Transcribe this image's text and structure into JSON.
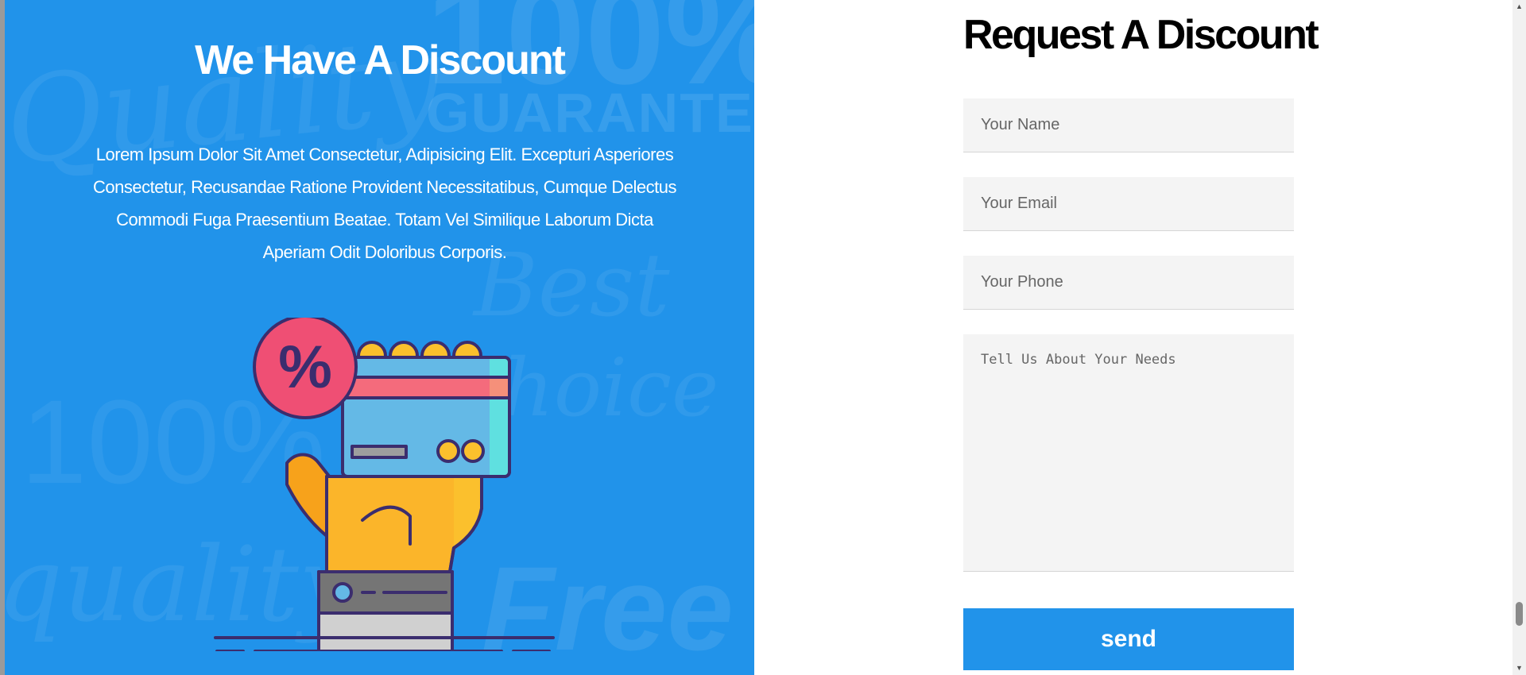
{
  "hero": {
    "title": "We Have A Discount",
    "description": "Lorem Ipsum Dolor Sit Amet Consectetur, Adipisicing Elit. Excepturi Asperiores Consectetur, Recusandae Ratione Provident Necessitatibus, Cumque Delectus Commodi Fuga Praesentium Beatae. Totam Vel Similique Laborum Dicta Aperiam Odit Doloribus Corporis.",
    "background_color": "#2193ea",
    "illustration_icon": "hand-holding-discount-card-illustration",
    "watermarks": [
      "Quality",
      "100%",
      "GUARANTEED",
      "Best",
      "Choice",
      "100%",
      "quality",
      "Free"
    ]
  },
  "form": {
    "title": "Request A Discount",
    "name_placeholder": "Your Name",
    "email_placeholder": "Your Email",
    "phone_placeholder": "Your Phone",
    "needs_placeholder": "Tell Us About Your Needs",
    "send_label": "send",
    "accent_color": "#2193ea",
    "field_background": "#f4f4f4"
  },
  "scrollbar": {
    "up_icon": "▲",
    "down_icon": "▼"
  }
}
